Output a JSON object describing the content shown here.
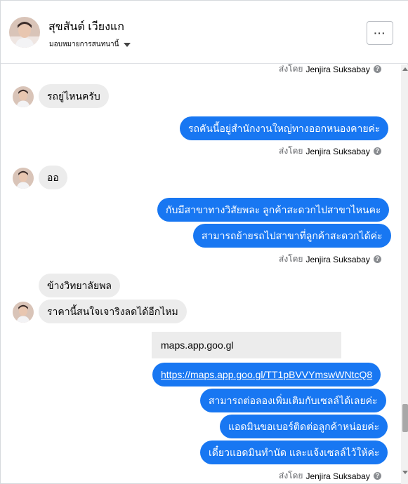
{
  "header": {
    "name": "สุขสันต์ เวียงแก",
    "status": "มอบหมายการสนทนานี้",
    "more_label": "···"
  },
  "sent_by": {
    "prefix": "ส่งโดย",
    "agent": "Jenjira Suksabay",
    "info": "?"
  },
  "messages": [
    {
      "text": "รถยู่ไหนครับ"
    },
    {
      "text": "รถคันนี้อยู่สำนักงานใหญ่ทางออกหนองคายค่ะ"
    },
    {
      "text": "ออ"
    },
    {
      "text": "กับมีสาขาทางวิสัยพละ ลูกค้าสะดวกไปสาขาไหนคะ"
    },
    {
      "text": "สามารถย้ายรถไปสาขาที่ลูกค้าสะดวกได้ค่ะ"
    },
    {
      "text": "ข้างวิทยาลัยพล"
    },
    {
      "text": "ราคานี้สนใจเจาริงลดได้อีกไหม"
    },
    {
      "text": "maps.app.goo.gl"
    },
    {
      "text": "https://maps.app.goo.gl/TT1pBVVYmswWNtcQ8"
    },
    {
      "text": "สามารถต่อลองเพิ่มเติมกับเซลล์ได้เลยค่ะ"
    },
    {
      "text": "แอดมินขอเบอร์ติดต่อลูกค้าหน่อยค่ะ"
    },
    {
      "text": "เดี๋ยวแอดมินทำนัด และแจ้งเซลล์ไว้ให้ค่ะ"
    }
  ],
  "colors": {
    "outgoing": "#1877f2",
    "incoming": "#ececec",
    "meta": "#65676b"
  },
  "icons": [
    "avatar",
    "chevron-down-icon",
    "more-icon",
    "info-icon",
    "scroll-up-icon",
    "scroll-down-icon"
  ]
}
